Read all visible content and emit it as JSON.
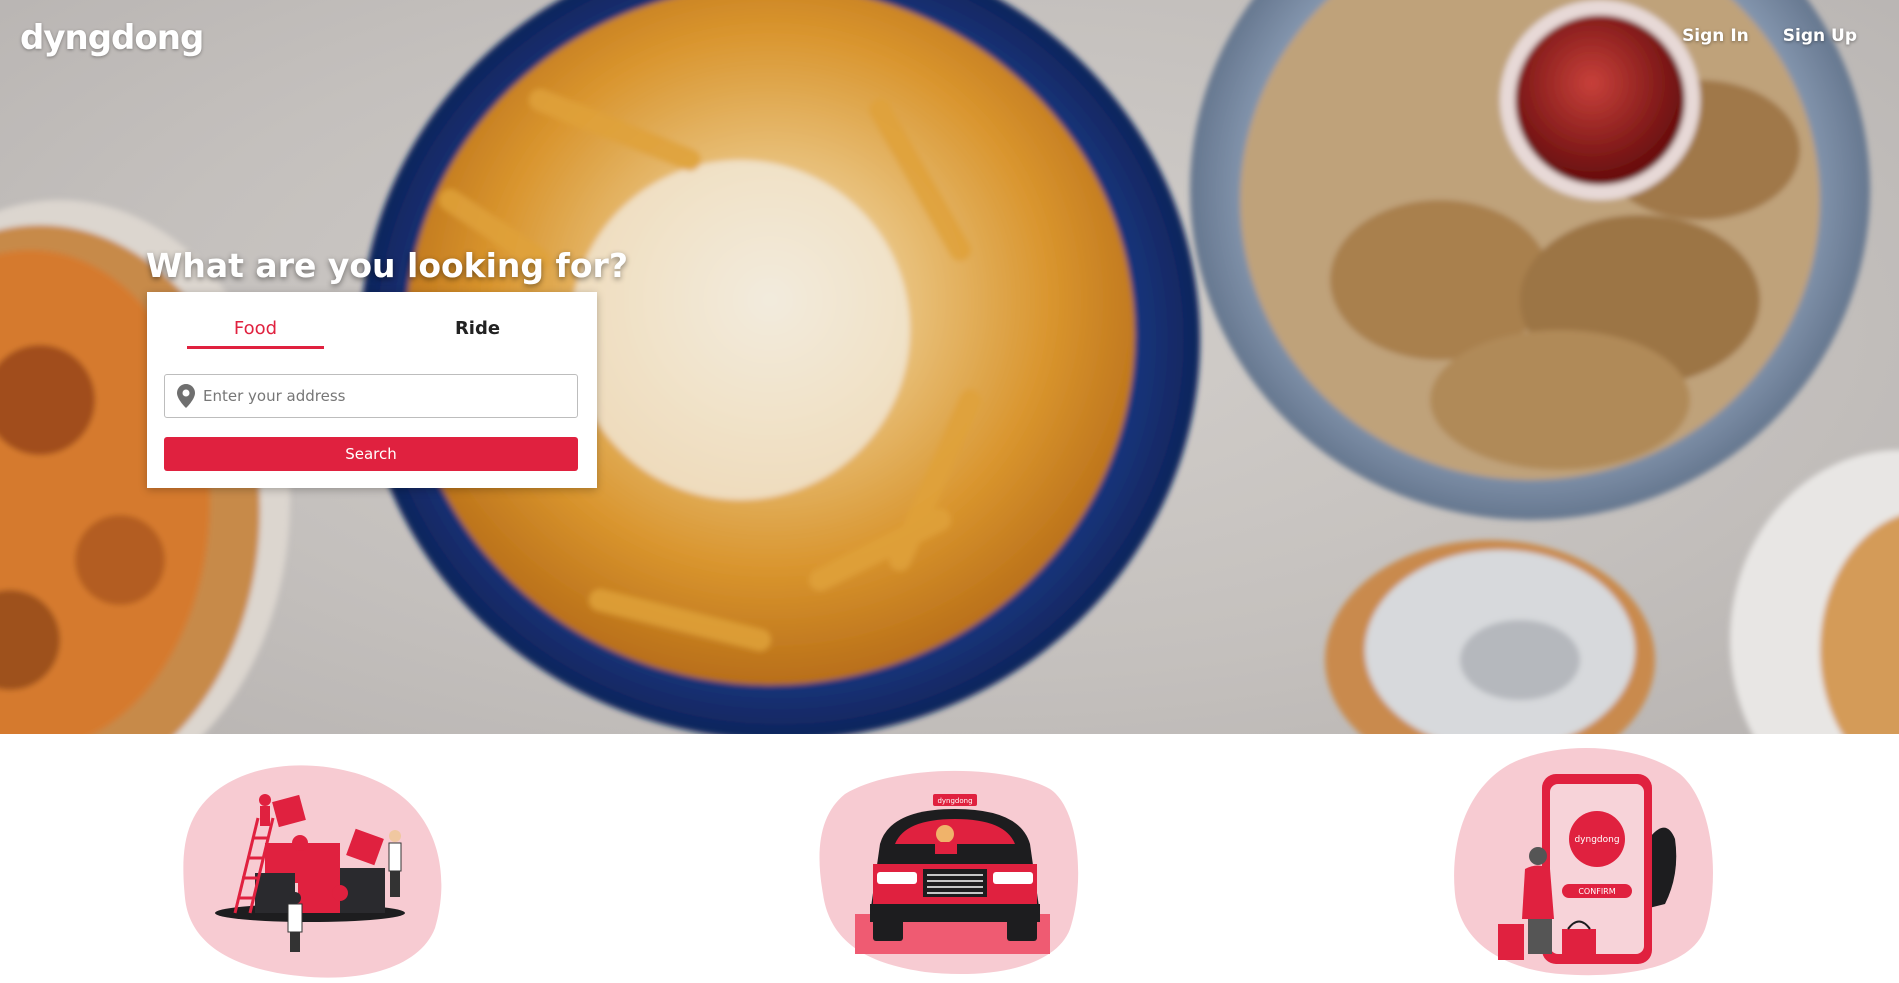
{
  "brand": {
    "logo": "dyngdong",
    "accent_color": "#e0213f"
  },
  "nav": {
    "sign_in": "Sign In",
    "sign_up": "Sign Up"
  },
  "hero": {
    "headline": "What are you looking for?",
    "tabs": [
      {
        "label": "Food",
        "active": true
      },
      {
        "label": "Ride",
        "active": false
      }
    ],
    "address": {
      "placeholder": "Enter your address",
      "value": "",
      "icon": "map-pin-icon"
    },
    "search_label": "Search"
  },
  "features": [
    {
      "name": "puzzle-team-illustration"
    },
    {
      "name": "car-driver-illustration",
      "sign": "dyngdong"
    },
    {
      "name": "phone-order-illustration",
      "logo": "dyngdong",
      "button": "CONFIRM"
    }
  ]
}
